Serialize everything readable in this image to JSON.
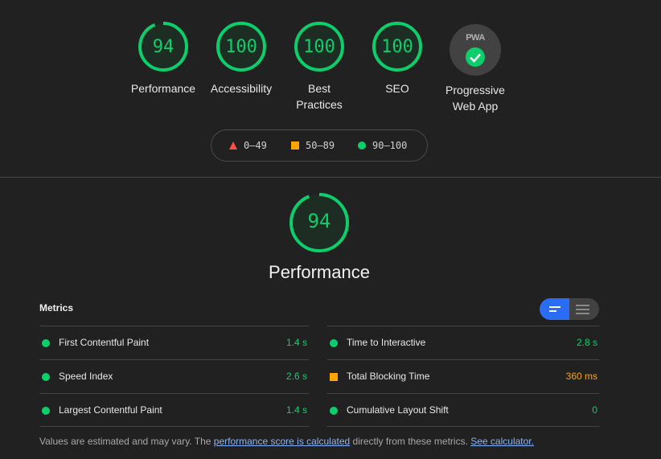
{
  "gauges": [
    {
      "score": "94",
      "label": "Performance"
    },
    {
      "score": "100",
      "label": "Accessibility"
    },
    {
      "score": "100",
      "label": "Best Practices"
    },
    {
      "score": "100",
      "label": "SEO"
    }
  ],
  "pwa": {
    "badge_text": "PWA",
    "label": "Progressive Web App"
  },
  "legend": {
    "red": "0–49",
    "orange": "50–89",
    "green": "90–100"
  },
  "performance": {
    "score": "94",
    "title": "Performance",
    "score_fraction": 0.94
  },
  "metrics": {
    "title": "Metrics",
    "items": [
      {
        "name": "First Contentful Paint",
        "value": "1.4 s",
        "status": "green"
      },
      {
        "name": "Time to Interactive",
        "value": "2.8 s",
        "status": "green"
      },
      {
        "name": "Speed Index",
        "value": "2.6 s",
        "status": "green"
      },
      {
        "name": "Total Blocking Time",
        "value": "360 ms",
        "status": "orange"
      },
      {
        "name": "Largest Contentful Paint",
        "value": "1.4 s",
        "status": "green"
      },
      {
        "name": "Cumulative Layout Shift",
        "value": "0",
        "status": "green"
      }
    ]
  },
  "footer": {
    "text1": "Values are estimated and may vary. The ",
    "link1": "performance score is calculated",
    "text2": " directly from these metrics. ",
    "link2": "See calculator."
  },
  "colors": {
    "green": "#0cce6b",
    "orange": "#ffa400",
    "red": "#ff4e42",
    "accent": "#2a6cf6"
  }
}
